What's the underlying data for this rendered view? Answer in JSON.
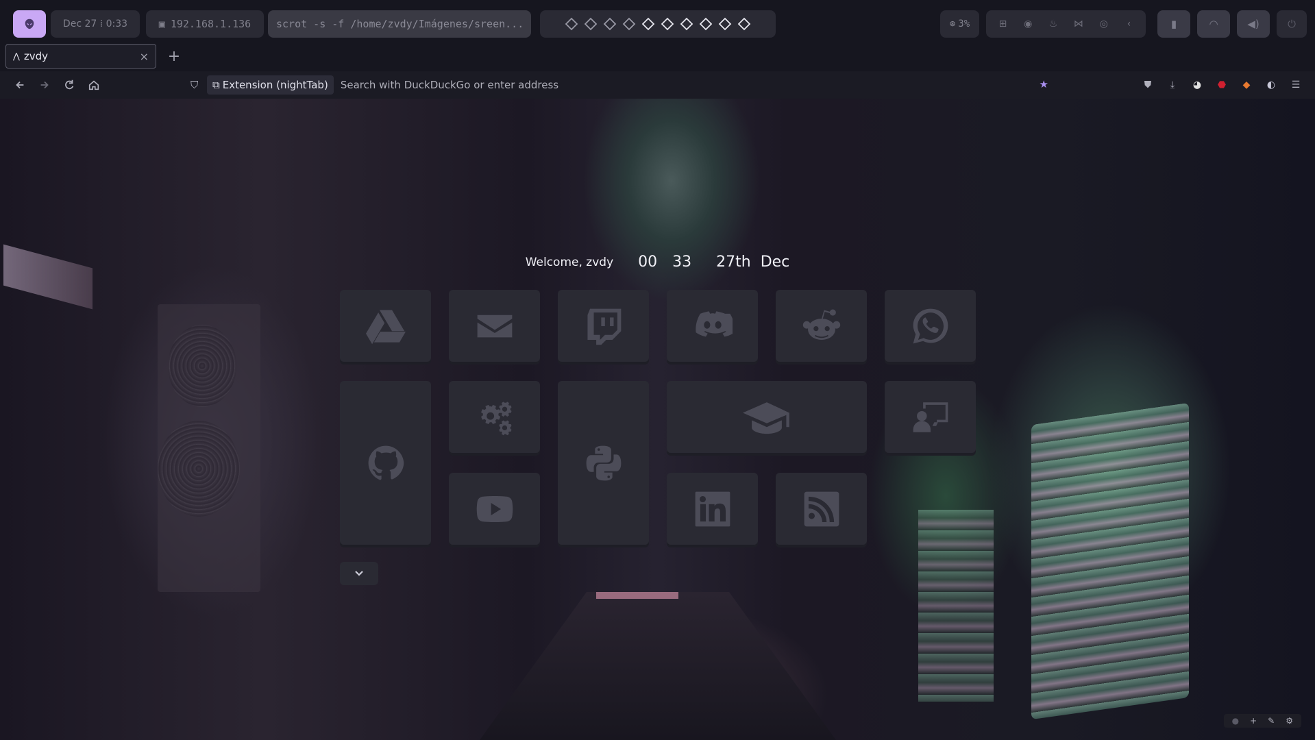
{
  "topbar": {
    "logo_icon": "alien-icon",
    "datetime": "Dec 27  ⁞  0:33",
    "ip": "192.168.1.136",
    "command": "scrot -s -f /home/zvdy/Imágenes/sreen...",
    "workspaces": [
      "outline",
      "outline",
      "outline",
      "outline",
      "filled",
      "filled",
      "filled",
      "filled",
      "filled",
      "filled"
    ],
    "cpu": "3%",
    "tray_icons": [
      "window-icon",
      "spotify-icon",
      "fire-icon",
      "vscode-icon",
      "github-icon",
      "chevron-left-icon"
    ],
    "buttons": [
      "clipboard-icon",
      "wifi-icon",
      "volume-icon",
      "power-icon"
    ]
  },
  "tab": {
    "title": "zvdy",
    "close": "×",
    "new": "+"
  },
  "navbar": {
    "extension_label": "Extension (nightTab)",
    "placeholder": "Search with DuckDuckGo or enter address"
  },
  "header": {
    "welcome": "Welcome, zvdy",
    "hour": "00",
    "minute": "33",
    "day": "27th",
    "month": "Dec"
  },
  "bookmarks": [
    {
      "name": "google-drive"
    },
    {
      "name": "mail"
    },
    {
      "name": "twitch"
    },
    {
      "name": "discord"
    },
    {
      "name": "reddit"
    },
    {
      "name": "whatsapp"
    },
    {
      "name": "github"
    },
    {
      "name": "settings"
    },
    {
      "name": "python"
    },
    {
      "name": "education"
    },
    {
      "name": "remote-desktop"
    },
    {
      "name": "youtube"
    },
    {
      "name": "linkedin"
    },
    {
      "name": "rss"
    }
  ],
  "colors": {
    "accent": "#c9a8f5",
    "tile": "#2a2a33",
    "icon": "#4c4c58",
    "star": "#a98ff0"
  }
}
